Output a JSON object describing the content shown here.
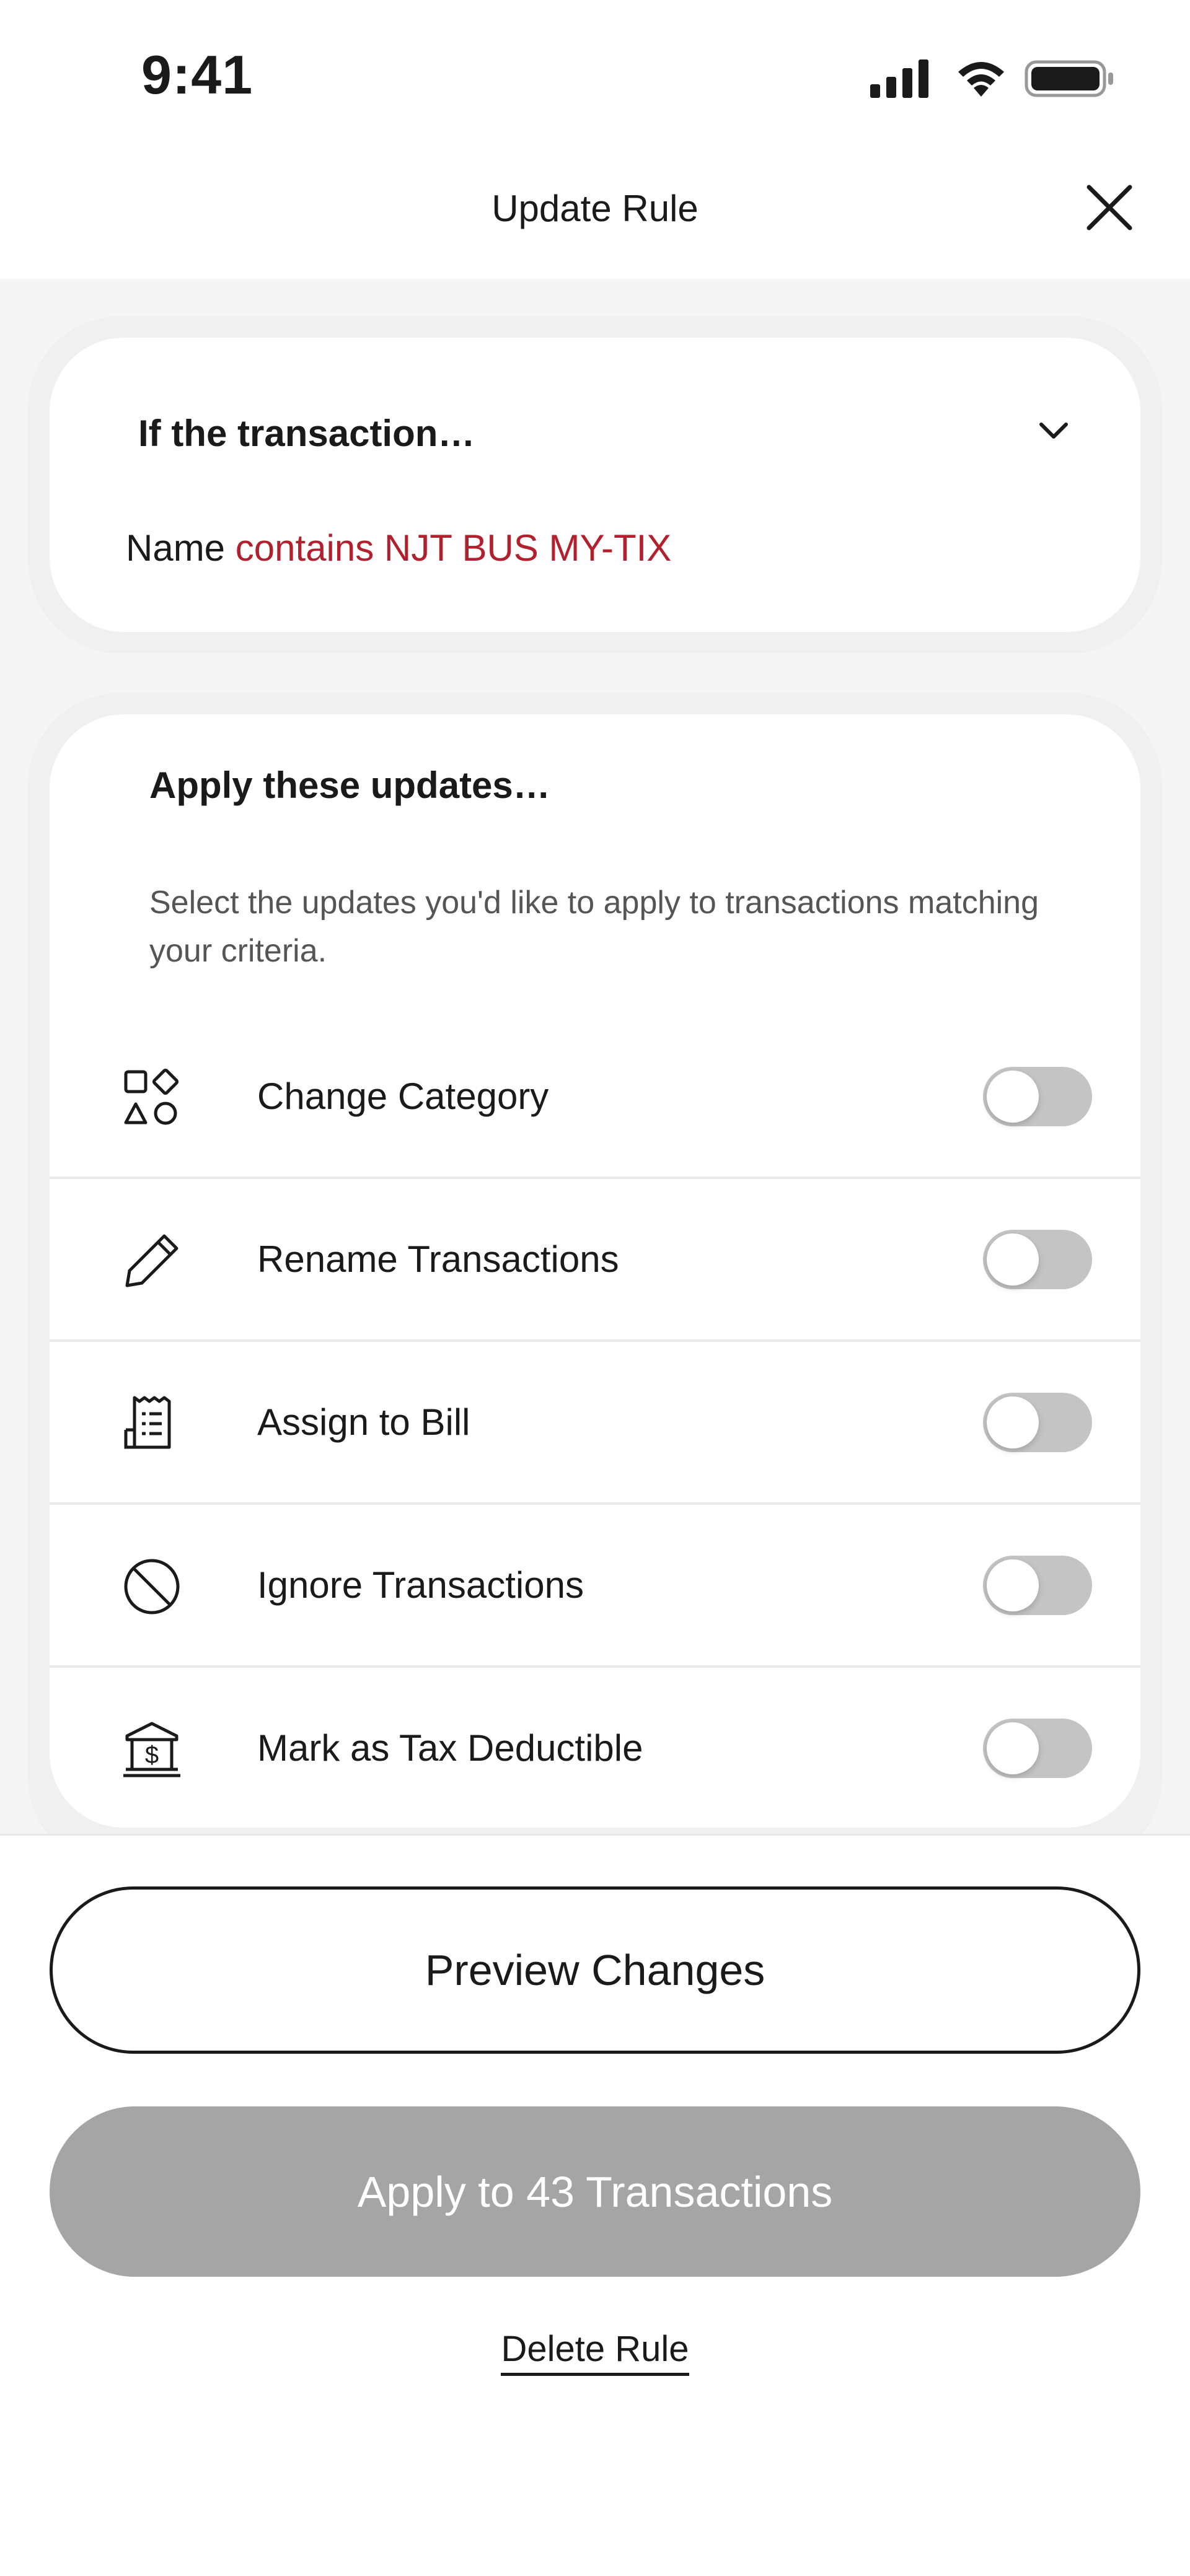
{
  "status_bar": {
    "time": "9:41",
    "icons": [
      "signal-icon",
      "wifi-icon",
      "battery-icon"
    ]
  },
  "header": {
    "title": "Update Rule",
    "close_icon": "close-icon"
  },
  "criteria": {
    "header": "If the transaction…",
    "field": "Name",
    "condition": "contains NJT BUS MY-TIX",
    "accent_color": "#b21f2d"
  },
  "updates": {
    "title": "Apply these updates…",
    "description": "Select the updates you'd like to apply to transactions matching your criteria.",
    "items": [
      {
        "label": "Change Category",
        "icon": "category-shapes-icon",
        "enabled": false
      },
      {
        "label": "Rename Transactions",
        "icon": "pencil-icon",
        "enabled": false
      },
      {
        "label": "Assign to Bill",
        "icon": "receipt-icon",
        "enabled": false
      },
      {
        "label": "Ignore Transactions",
        "icon": "prohibited-icon",
        "enabled": false
      },
      {
        "label": "Mark as Tax Deductible",
        "icon": "bank-dollar-icon",
        "enabled": false
      }
    ]
  },
  "actions": {
    "preview_label": "Preview Changes",
    "apply_label": "Apply to 43 Transactions",
    "delete_label": "Delete Rule"
  },
  "colors": {
    "toggle_off": "#c4c4c4",
    "apply_disabled": "#a5a5a5",
    "background": "#f5f5f5"
  }
}
